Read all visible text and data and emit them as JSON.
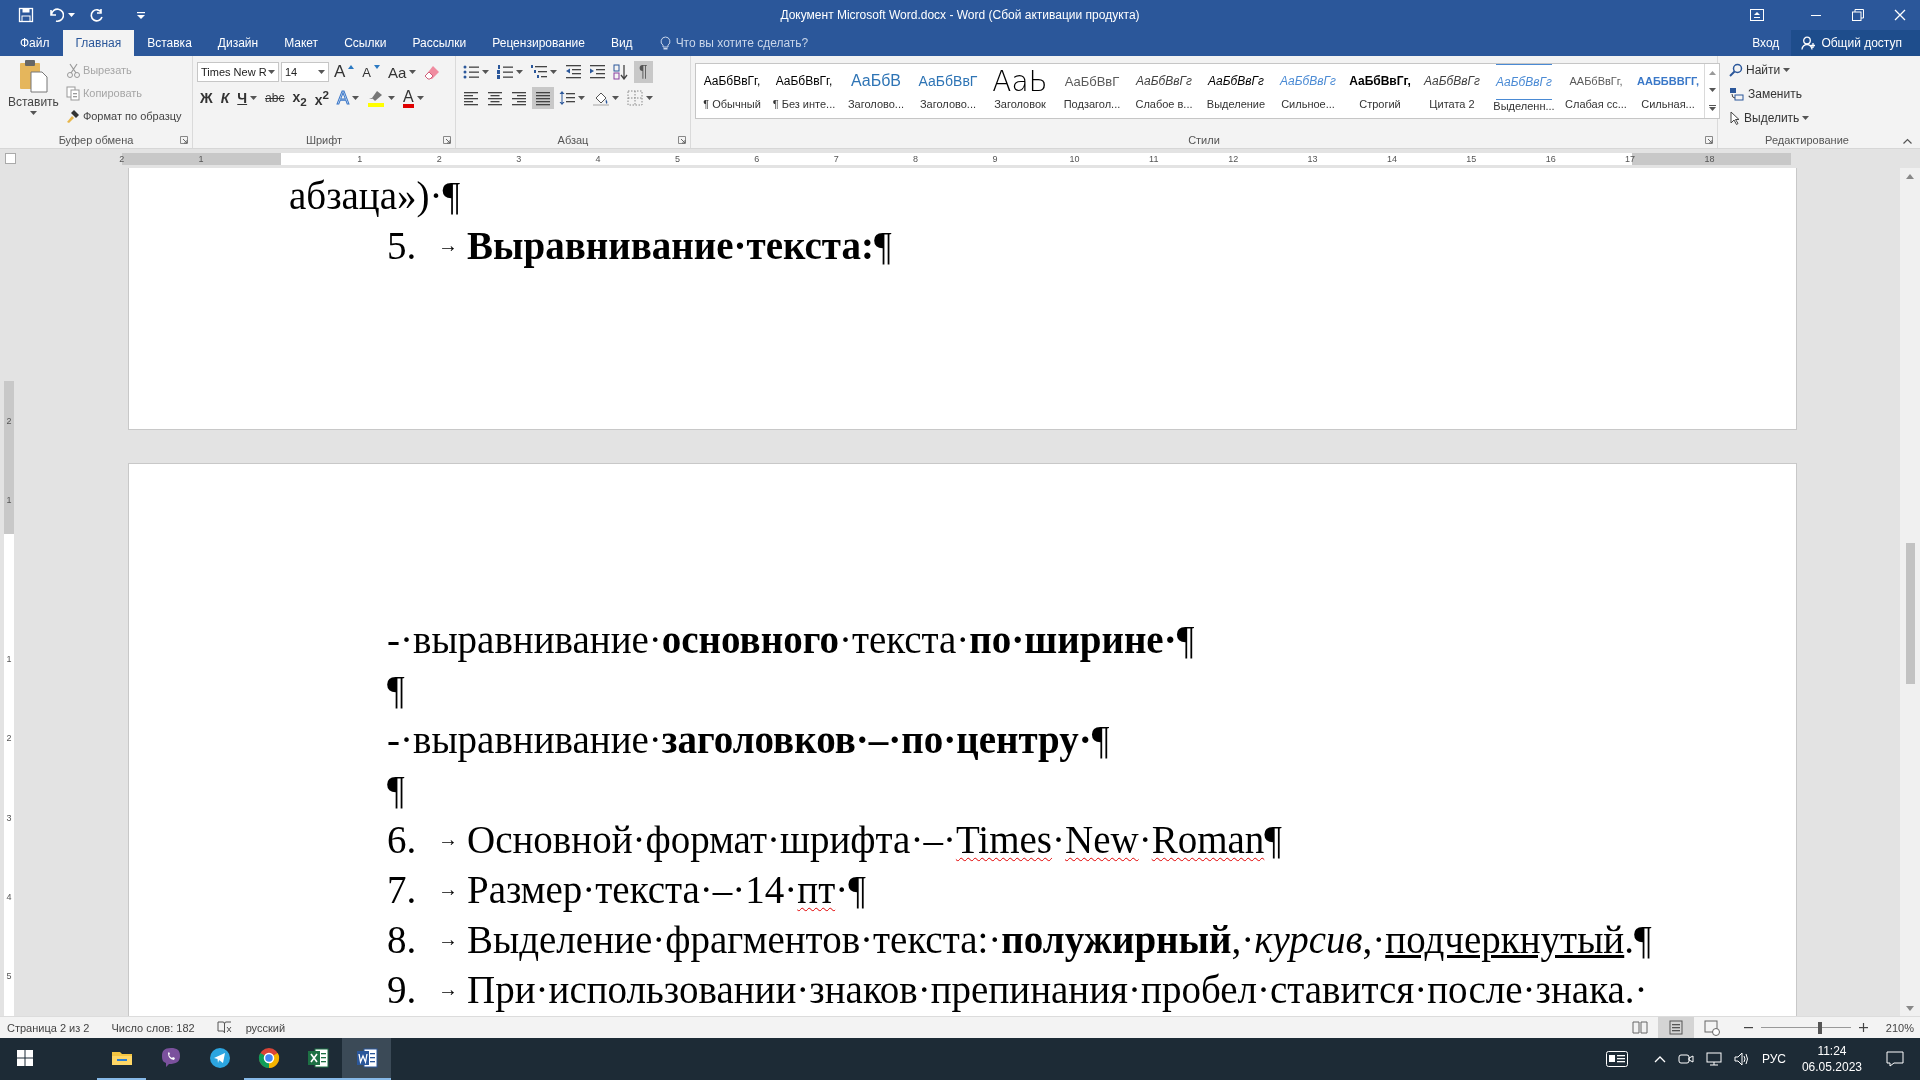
{
  "window": {
    "title": "Документ Microsoft Word.docx - Word (Сбой активации продукта)"
  },
  "menu_tabs": [
    {
      "label": "Файл",
      "selected": false
    },
    {
      "label": "Главная",
      "selected": true
    },
    {
      "label": "Вставка",
      "selected": false
    },
    {
      "label": "Дизайн",
      "selected": false
    },
    {
      "label": "Макет",
      "selected": false
    },
    {
      "label": "Ссылки",
      "selected": false
    },
    {
      "label": "Рассылки",
      "selected": false
    },
    {
      "label": "Рецензирование",
      "selected": false
    },
    {
      "label": "Вид",
      "selected": false
    }
  ],
  "tell_me": {
    "placeholder": "Что вы хотите сделать?"
  },
  "account": {
    "sign_in": "Вход",
    "share": "Общий доступ"
  },
  "clipboard": {
    "paste": "Вставить",
    "label": "Буфер обмена",
    "actions": [
      {
        "kind": "cut",
        "label": "Вырезать",
        "disabled": true
      },
      {
        "kind": "copy",
        "label": "Копировать",
        "disabled": true
      },
      {
        "kind": "painter",
        "label": "Формат по образцу",
        "disabled": false
      }
    ]
  },
  "font": {
    "name": "Times New R",
    "size": "14",
    "label": "Шрифт",
    "row1": [
      {
        "kind": "grow",
        "label": "A"
      },
      {
        "kind": "shrink",
        "label": "A"
      },
      {
        "kind": "case",
        "label": "Aa"
      },
      {
        "kind": "clear"
      }
    ],
    "row2": [
      {
        "kind": "bold",
        "label": "Ж"
      },
      {
        "kind": "italic",
        "label": "К"
      },
      {
        "kind": "underline",
        "label": "Ч"
      },
      {
        "kind": "strike",
        "label": "abc"
      },
      {
        "kind": "sub",
        "label": "x$_{2}$"
      },
      {
        "kind": "sup",
        "label": "x$^{2}$"
      },
      {
        "kind": "effects",
        "label": "A"
      },
      {
        "kind": "highlight"
      },
      {
        "kind": "fontcolor",
        "label": "A"
      }
    ]
  },
  "paragraph": {
    "label": "Абзац",
    "row1": [
      {
        "kind": "bullets",
        "on": false
      },
      {
        "kind": "numbering",
        "on": false
      },
      {
        "kind": "multilevel",
        "on": false
      },
      {
        "kind": "outdent",
        "on": false
      },
      {
        "kind": "indent",
        "on": false
      },
      {
        "kind": "sort",
        "on": false
      },
      {
        "kind": "marks",
        "label": "¶",
        "on": true
      }
    ],
    "row2": [
      {
        "kind": "left",
        "on": false
      },
      {
        "kind": "center",
        "on": false
      },
      {
        "kind": "right",
        "on": false
      },
      {
        "kind": "justify",
        "on": true
      },
      {
        "kind": "spacing",
        "on": false
      },
      {
        "kind": "shading",
        "on": false
      },
      {
        "kind": "borders",
        "on": false
      }
    ]
  },
  "styles": {
    "label": "Стили",
    "items": [
      {
        "kind": "normal",
        "preview": "АаБбВвГг,",
        "label": "¶ Обычный"
      },
      {
        "kind": "normal",
        "preview": "АаБбВвГг,",
        "label": "¶ Без инте..."
      },
      {
        "kind": "heading1",
        "preview": "АаБбВ",
        "label": "Заголово..."
      },
      {
        "kind": "heading2",
        "preview": "АаБбВвГ",
        "label": "Заголово..."
      },
      {
        "kind": "title",
        "preview": "АаЬ",
        "label": "Заголовок"
      },
      {
        "kind": "subtitle",
        "preview": "АаБбВвГ",
        "label": "Подзагол..."
      },
      {
        "kind": "subtle",
        "preview": "АаБбВвГг",
        "label": "Слабое в..."
      },
      {
        "kind": "emphasis",
        "preview": "АаБбВвГг",
        "label": "Выделение"
      },
      {
        "kind": "intense",
        "preview": "АаБбВвГг",
        "label": "Сильное..."
      },
      {
        "kind": "strong",
        "preview": "АаБбВвГг,",
        "label": "Строгий"
      },
      {
        "kind": "subtle",
        "preview": "АаБбВвГг",
        "label": "Цитата 2"
      },
      {
        "kind": "intensequote",
        "preview": "АаБбВвГг",
        "label": "Выделенн..."
      },
      {
        "kind": "subtleref",
        "preview": "ААБбВвГг,",
        "label": "Слабая сс..."
      },
      {
        "kind": "intenseref",
        "preview": "ААББВВГГ,",
        "label": "Сильная..."
      }
    ]
  },
  "editing": {
    "label": "Редактирование",
    "items": [
      {
        "kind": "find",
        "label": "Найти"
      },
      {
        "kind": "replace",
        "label": "Заменить"
      },
      {
        "kind": "select",
        "label": "Выделить"
      }
    ]
  },
  "ruler": {
    "left_labels": [
      "2",
      "1"
    ],
    "labels": [
      "1",
      "2",
      "3",
      "4",
      "5",
      "6",
      "7",
      "8",
      "9",
      "10",
      "11",
      "12",
      "13",
      "14",
      "15",
      "16",
      "17",
      "18"
    ]
  },
  "vertical_ruler": {
    "top_labels": [
      "2",
      "1"
    ],
    "labels": [
      "1",
      "2",
      "3",
      "4",
      "5"
    ]
  },
  "pages": [
    {
      "paragraphs": [
        {
          "kind": "continuation",
          "segments": [
            {
              "kind": "plain",
              "text": "абзаца»)·¶"
            }
          ]
        },
        {
          "kind": "numbered",
          "number": "5.",
          "tab": "→",
          "segments": [
            {
              "kind": "bold",
              "text": "Выравнивание·текста:"
            },
            {
              "kind": "plain",
              "text": "¶"
            }
          ]
        }
      ]
    },
    {
      "paragraphs": [
        {
          "kind": "plain",
          "segments": [
            {
              "kind": "plain",
              "text": "-·выравнивание·"
            },
            {
              "kind": "bold",
              "text": "основного"
            },
            {
              "kind": "plain",
              "text": "·текста·"
            },
            {
              "kind": "bold",
              "text": "по·ширине·"
            },
            {
              "kind": "plain",
              "text": "¶"
            }
          ]
        },
        {
          "kind": "mark",
          "segments": [
            {
              "kind": "plain",
              "text": "¶"
            }
          ]
        },
        {
          "kind": "plain",
          "segments": [
            {
              "kind": "plain",
              "text": "-·выравнивание·"
            },
            {
              "kind": "bold",
              "text": "заголовков·–·по·центру·"
            },
            {
              "kind": "plain",
              "text": "¶"
            }
          ]
        },
        {
          "kind": "mark",
          "segments": [
            {
              "kind": "plain",
              "text": "¶"
            }
          ]
        },
        {
          "kind": "numbered",
          "number": "6.",
          "tab": "→",
          "segments": [
            {
              "kind": "plain",
              "text": "Основной·формат·шрифта·–·"
            },
            {
              "kind": "misspelled",
              "text": "Times"
            },
            {
              "kind": "plain",
              "text": "·"
            },
            {
              "kind": "misspelled",
              "text": "New"
            },
            {
              "kind": "plain",
              "text": "·"
            },
            {
              "kind": "misspelled",
              "text": "Roman"
            },
            {
              "kind": "plain",
              "text": "¶"
            }
          ]
        },
        {
          "kind": "numbered",
          "number": "7.",
          "tab": "→",
          "segments": [
            {
              "kind": "plain",
              "text": "Размер·текста·–·14·"
            },
            {
              "kind": "misspelled",
              "text": "пт"
            },
            {
              "kind": "plain",
              "text": "·¶"
            }
          ]
        },
        {
          "kind": "numbered",
          "number": "8.",
          "tab": "→",
          "segments": [
            {
              "kind": "plain",
              "text": "Выделение·фрагментов·текста:·"
            },
            {
              "kind": "bold",
              "text": "полужирный"
            },
            {
              "kind": "plain",
              "text": ",·"
            },
            {
              "kind": "italic",
              "text": "курсив"
            },
            {
              "kind": "plain",
              "text": ",·"
            },
            {
              "kind": "underline",
              "text": "подчеркнутый"
            },
            {
              "kind": "plain",
              "text": ".¶"
            }
          ]
        },
        {
          "kind": "numbered",
          "number": "9.",
          "tab": "→",
          "segments": [
            {
              "kind": "plain",
              "text": "При·использовании·знаков·препинания·пробел·ставится·после·знака.·"
            }
          ]
        }
      ]
    }
  ],
  "status_bar": {
    "page": "Страница 2 из 2",
    "words": "Число слов: 182",
    "language": "русский",
    "views": [
      {
        "kind": "read",
        "selected": false
      },
      {
        "kind": "print",
        "selected": true
      },
      {
        "kind": "web",
        "selected": false
      }
    ],
    "zoom": {
      "level": 0.66,
      "label": "210%"
    }
  },
  "taskbar": {
    "apps": [
      {
        "kind": "explorer",
        "running": true,
        "selected": false
      },
      {
        "kind": "viber",
        "running": false,
        "selected": false
      },
      {
        "kind": "telegram",
        "running": false,
        "selected": false
      },
      {
        "kind": "chrome",
        "running": true,
        "selected": false
      },
      {
        "kind": "excel",
        "running": true,
        "selected": false
      },
      {
        "kind": "word",
        "running": true,
        "selected": true
      }
    ],
    "language": "РУС",
    "time": "11:24",
    "date": "06.05.2023"
  }
}
